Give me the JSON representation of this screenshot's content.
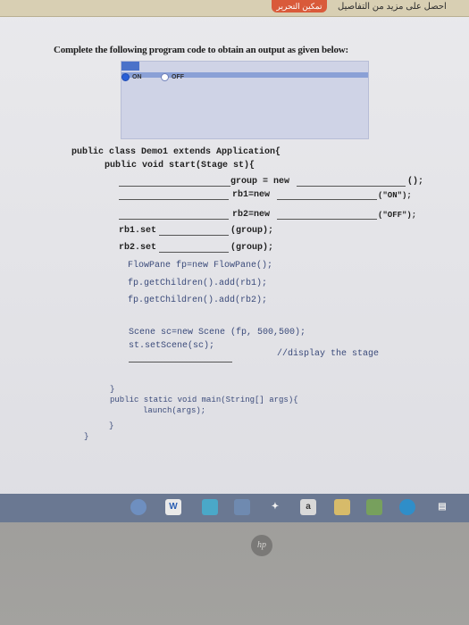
{
  "topbar": {
    "button_label": "تمكين التحرير",
    "rtl_text": "احصل على مزيد من التفاصيل"
  },
  "question": "Complete the following program code to obtain an output as given below:",
  "preview": {
    "radio_on": "ON",
    "radio_off": "OFF"
  },
  "code": {
    "l1": "public class Demo1 extends Application{",
    "l2": "public void start(Stage st){",
    "group_new": "group = new",
    "group_end": "();",
    "rb1": "rb1=new",
    "rb1_end": "(\"ON\");",
    "rb2": "rb2=new",
    "rb2_end": "(\"OFF\");",
    "rb1_set": "rb1.set",
    "rb1_group": "(group);",
    "rb2_set": "rb2.set",
    "rb2_group": "(group);",
    "fp": "FlowPane fp=new FlowPane();",
    "add1": "fp.getChildren().add(rb1);",
    "add2": "fp.getChildren().add(rb2);",
    "scene": "Scene sc=new Scene (fp, 500,500);",
    "setscene": "st.setScene(sc);",
    "comment": "//display the stage",
    "close1": "}",
    "main": "public static void main(String[] args){",
    "launch": "launch(args);",
    "close2": "}",
    "close3": "}"
  },
  "taskbar": {
    "word_icon": "W",
    "a_icon": "a"
  },
  "bezel": {
    "logo": "hp"
  }
}
